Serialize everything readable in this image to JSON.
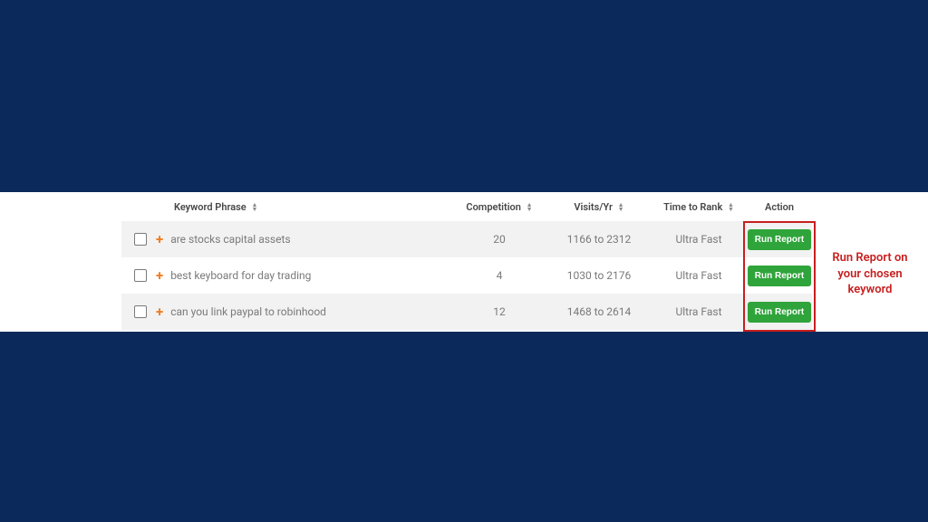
{
  "headers": {
    "keyword": "Keyword Phrase",
    "competition": "Competition",
    "visits": "Visits/Yr",
    "timeToRank": "Time to Rank",
    "action": "Action"
  },
  "buttons": {
    "runReport": "Run Report"
  },
  "rows": [
    {
      "keyword": "are stocks capital assets",
      "competition": "20",
      "visits": "1166 to 2312",
      "timeToRank": "Ultra Fast"
    },
    {
      "keyword": "best keyboard for day trading",
      "competition": "4",
      "visits": "1030 to 2176",
      "timeToRank": "Ultra Fast"
    },
    {
      "keyword": "can you link paypal to robinhood",
      "competition": "12",
      "visits": "1468 to 2614",
      "timeToRank": "Ultra Fast"
    }
  ],
  "annotation": "Run Report on your chosen keyword",
  "colors": {
    "pageBg": "#0b2a5b",
    "accentOrange": "#ef7e24",
    "buttonGreen": "#2fa43b",
    "highlightRed": "#c81e1e"
  }
}
